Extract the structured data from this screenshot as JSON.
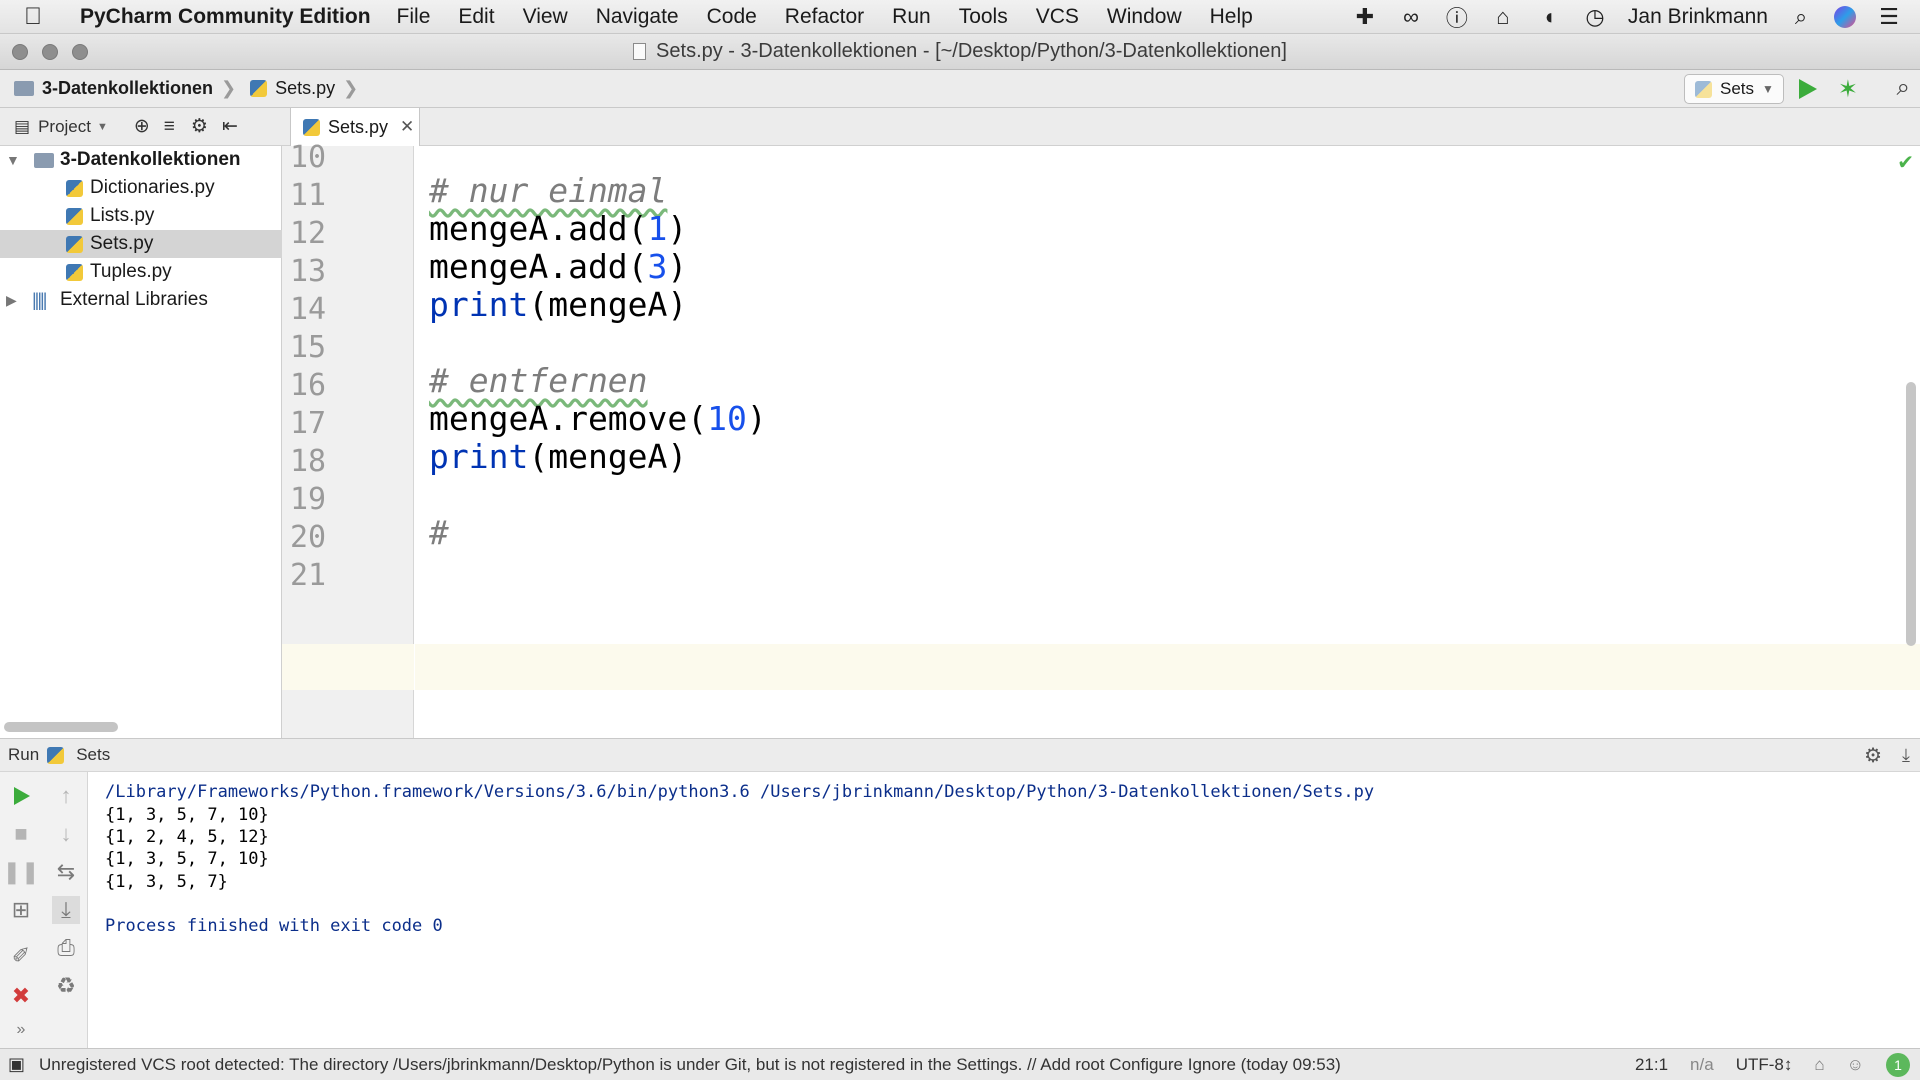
{
  "menubar": {
    "app_name": "PyCharm Community Edition",
    "items": [
      "File",
      "Edit",
      "View",
      "Navigate",
      "Code",
      "Refactor",
      "Run",
      "Tools",
      "VCS",
      "Window",
      "Help"
    ],
    "user": "Jan Brinkmann",
    "status_icons": [
      "plus-icon",
      "creative-cloud-icon",
      "password-icon",
      "notification-icon",
      "leaf-icon",
      "time-machine-icon",
      "spotlight-search-icon",
      "siri-icon",
      "list-icon"
    ]
  },
  "window": {
    "title": "Sets.py - 3-Datenkollektionen - [~/Desktop/Python/3-Datenkollektionen]"
  },
  "navbar": {
    "breadcrumb": [
      "3-Datenkollektionen",
      "Sets.py"
    ],
    "run_config": "Sets"
  },
  "project": {
    "label": "Project",
    "root": "3-Datenkollektionen",
    "files": [
      "Dictionaries.py",
      "Lists.py",
      "Sets.py",
      "Tuples.py"
    ],
    "selected": "Sets.py",
    "external": "External Libraries"
  },
  "editor": {
    "tab": "Sets.py",
    "lines": [
      {
        "no": "10",
        "code": ""
      },
      {
        "no": "11",
        "code": "# nur einmal"
      },
      {
        "no": "12",
        "code": "mengeA.add(1)"
      },
      {
        "no": "13",
        "code": "mengeA.add(3)"
      },
      {
        "no": "14",
        "code": "print(mengeA)"
      },
      {
        "no": "15",
        "code": ""
      },
      {
        "no": "16",
        "code": "# entfernen"
      },
      {
        "no": "17",
        "code": "mengeA.remove(10)"
      },
      {
        "no": "18",
        "code": "print(mengeA)"
      },
      {
        "no": "19",
        "code": ""
      },
      {
        "no": "20",
        "code": "#"
      },
      {
        "no": "21",
        "code": ""
      }
    ],
    "current_line": "21"
  },
  "run": {
    "label": "Run",
    "config": "Sets",
    "command": "/Library/Frameworks/Python.framework/Versions/3.6/bin/python3.6 /Users/jbrinkmann/Desktop/Python/3-Datenkollektionen/Sets.py",
    "output": [
      "{1, 3, 5, 7, 10}",
      "{1, 2, 4, 5, 12}",
      "{1, 3, 5, 7, 10}",
      "{1, 3, 5, 7}"
    ],
    "exit_message": "Process finished with exit code 0"
  },
  "statusbar": {
    "message": "Unregistered VCS root detected: The directory /Users/jbrinkmann/Desktop/Python is under Git, but is not registered in the Settings. // Add root  Configure  Ignore (today 09:53)",
    "position": "21:1",
    "na": "n/a",
    "encoding": "UTF-8↕",
    "notifications": "1"
  }
}
